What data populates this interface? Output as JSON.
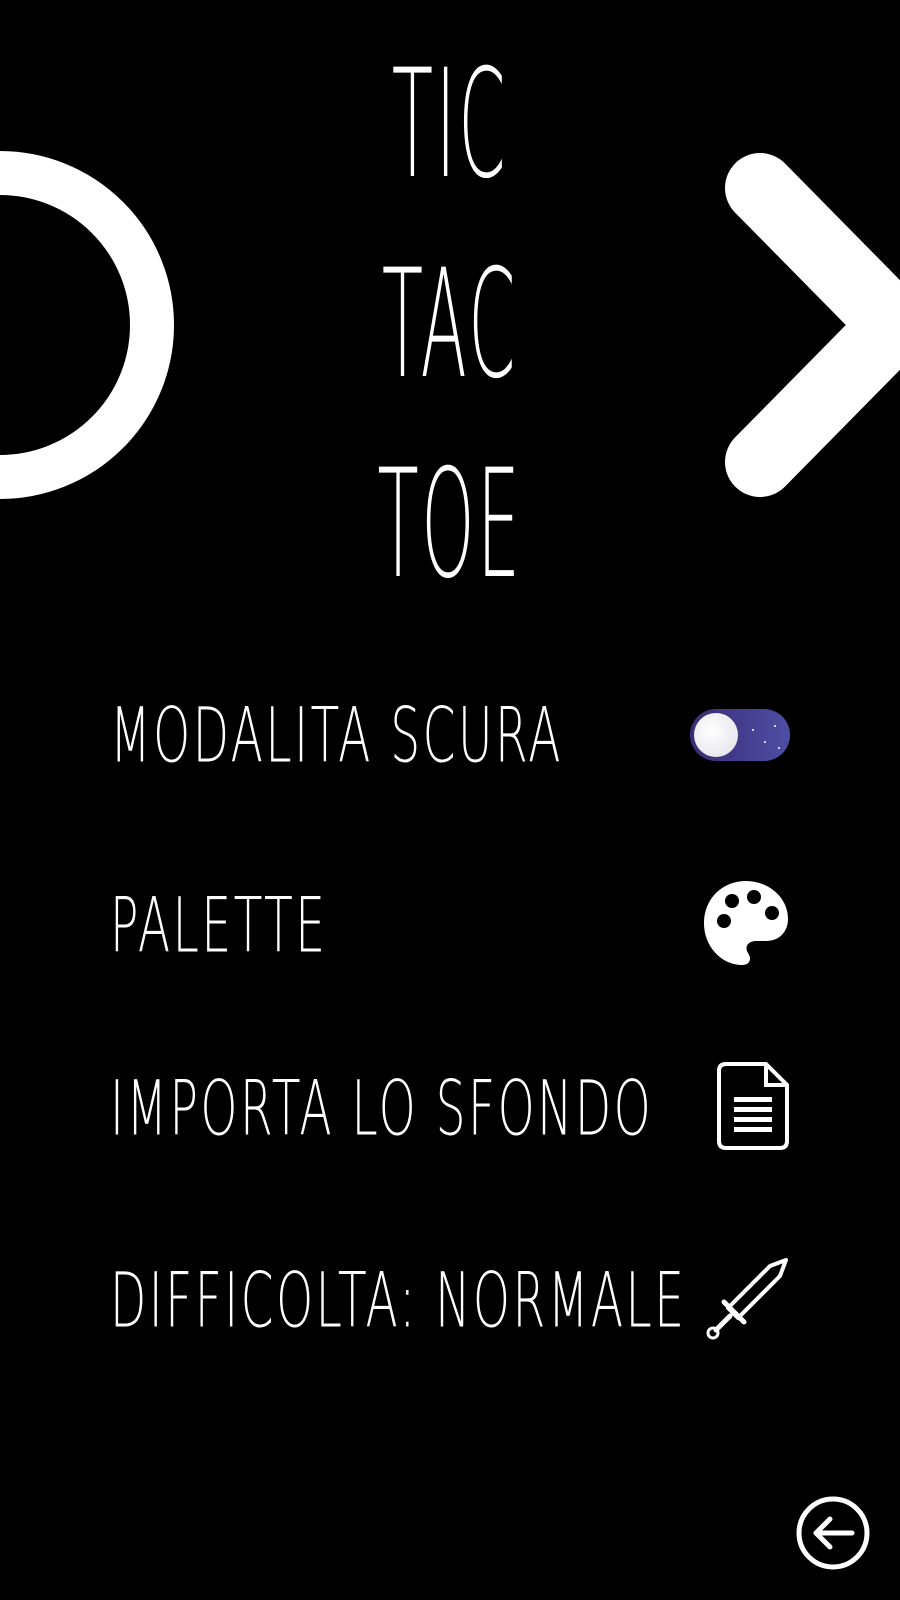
{
  "title": {
    "line1": "TIC",
    "line2": "TAC",
    "line3": "TOE"
  },
  "decorations": {
    "left_symbol": "o-mark",
    "right_symbol": "x-mark"
  },
  "settings": [
    {
      "id": "dark-mode",
      "label": "MODALITA SCURA",
      "icon": "moon-toggle-icon",
      "enabled": true,
      "toggle_colors": [
        "#3a2c74",
        "#4e4ea6"
      ]
    },
    {
      "id": "palette",
      "label": "PALETTE",
      "icon": "palette-icon"
    },
    {
      "id": "import-background",
      "label": "IMPORTA LO SFONDO",
      "icon": "document-icon"
    },
    {
      "id": "difficulty",
      "label": "DIFFICOLTA: NORMALE",
      "icon": "sword-icon"
    }
  ],
  "back_button": {
    "icon": "back-arrow-icon"
  },
  "colors": {
    "background": "#000000",
    "foreground": "#ffffff"
  }
}
